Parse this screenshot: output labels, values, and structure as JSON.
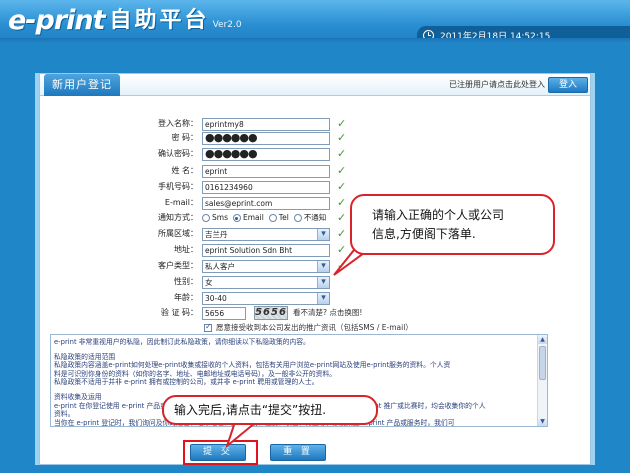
{
  "header": {
    "logo_text": "e-print",
    "title_cn": "自助平台",
    "version": "Ver2.0",
    "datetime": "2011年2月18日 14:52:15"
  },
  "panel": {
    "tab_title": "新用户登记",
    "login_hint": "已注册用户请点击此处登入",
    "login_button": "登入"
  },
  "form": {
    "fields": [
      {
        "label": "登入名称：",
        "value": "eprintmy8",
        "type": "text",
        "valid": true
      },
      {
        "label": "密 码：",
        "value": "●●●●●●",
        "type": "password",
        "valid": true
      },
      {
        "label": "确认密码：",
        "value": "●●●●●●",
        "type": "password",
        "valid": true
      },
      {
        "label": "姓 名：",
        "value": "eprint",
        "type": "text",
        "valid": true
      },
      {
        "label": "手机号码：",
        "value": "0161234960",
        "type": "text",
        "valid": true
      },
      {
        "label": "E-mail：",
        "value": "sales@eprint.com",
        "type": "text",
        "valid": true
      }
    ],
    "notify": {
      "label": "通知方式：",
      "options": [
        "Sms",
        "Email",
        "Tel",
        "不通知"
      ],
      "selected": "Email"
    },
    "region": {
      "label": "所属区域：",
      "value": "吉兰丹"
    },
    "address": {
      "label": "地址：",
      "value": "eprint Solution Sdn Bht"
    },
    "customer_type": {
      "label": "客户类型：",
      "value": "私人客户"
    },
    "gender": {
      "label": "性别：",
      "value": "女"
    },
    "age": {
      "label": "年龄：",
      "value": "30-40"
    },
    "captcha": {
      "label": "验 证 码：",
      "value": "5656",
      "image_text": "5656",
      "hint": "看不清楚? 点击换图!"
    },
    "agree_text": "愿意接受收到本公司发出的推广资讯（包括SMS / E-mail）"
  },
  "policy": {
    "lines": [
      "e-print 非常重视用户的私隐，因此制订此私隐政策，请你细读以下私隐政策的内容。",
      "",
      "私隐政策的适用范围",
      "私隐政策内容涵盖e-print如何处理e-print收集或接收的个人资料，包括有关用户浏览e-print网站及使用e-print服务的资料。个人资",
      "料是可识别你身份的资料（如你的名字、地址、电邮地址或电话号码），及一般非公开的资料。",
      "私隐政策不适用于并非 e-print 拥有或控制的公司，或并非 e-print 聘用或管理的人士。",
      "",
      "资料收集及运用",
      "e-print 在你登记使用 e-print 产品或服务、使用 e-print 某些产品或服务、浏览 e-print 网页或参与 e-print 推广或比赛时，均会收集你的个人",
      "资料。",
      "当你在 e-print 登记时，我们询问及你的姓名、电邮地址、出生日期、性别、职位、行业等；涉及某些 e-print 产品或服务时，我们可"
    ]
  },
  "buttons": {
    "submit": "提 交",
    "reset": "重 置"
  },
  "callouts": {
    "tip1_line1": "请输入正确的个人或公司",
    "tip1_line2": "信息,方便阁下落单.",
    "tip2": "输入完后,请点击“提交”按扭."
  },
  "colors": {
    "header_blue": "#2a8fd2",
    "accent_red": "#e0141d",
    "check_green": "#3f9b2d"
  }
}
